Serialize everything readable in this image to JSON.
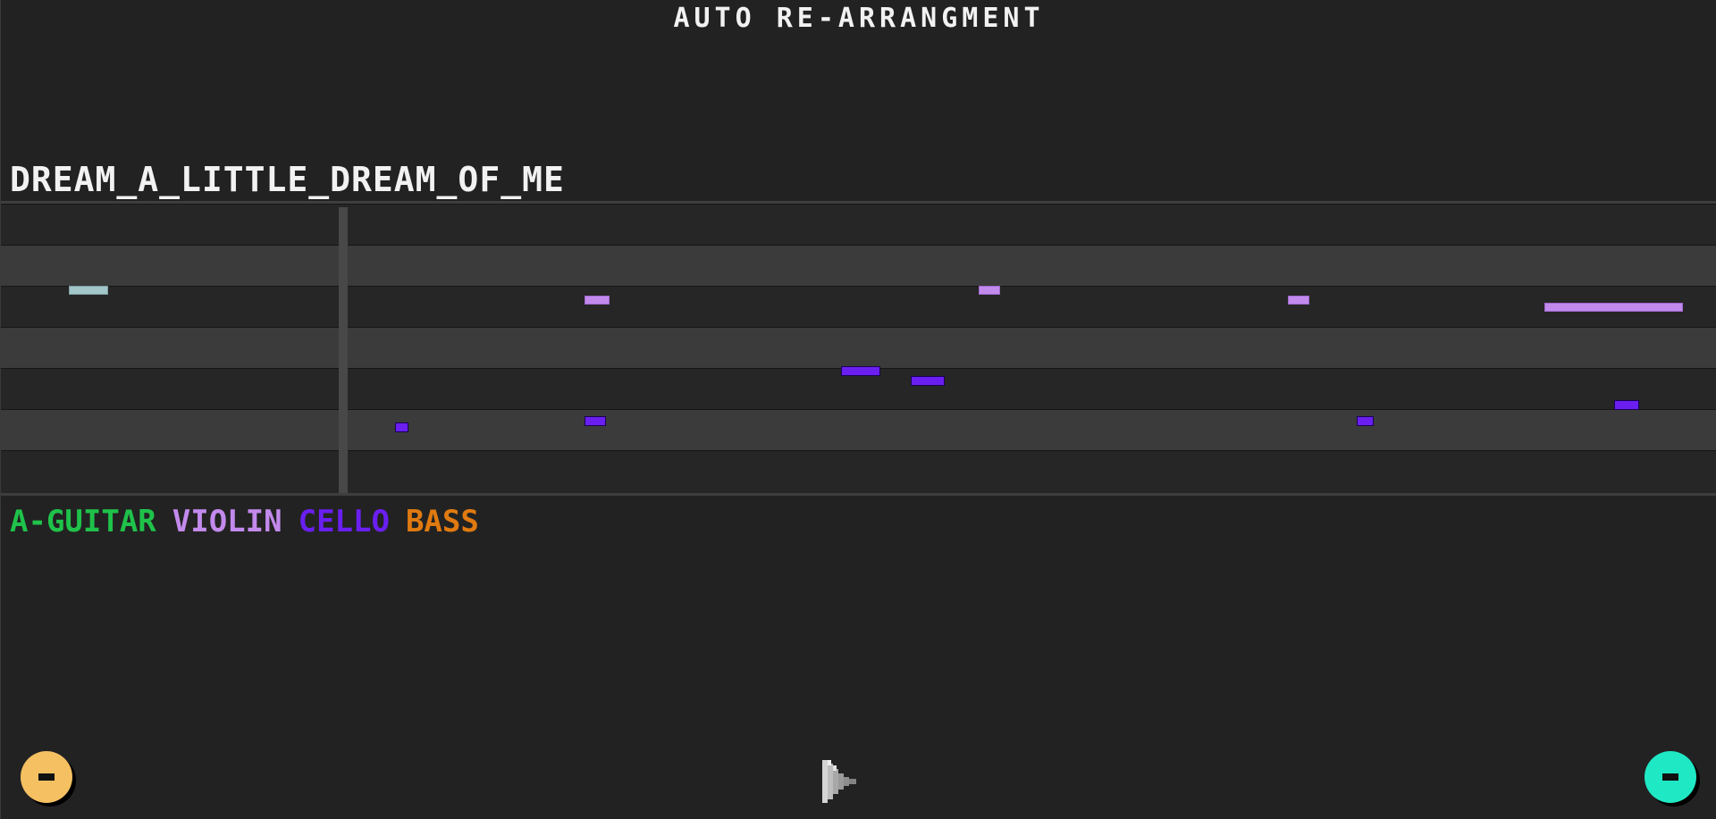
{
  "app": {
    "title": "AUTO RE-ARRANGMENT"
  },
  "song": {
    "title": "DREAM_A_LITTLE_DREAM_OF_ME"
  },
  "legend": [
    {
      "label": "A-GUITAR",
      "color": "#1fc24a"
    },
    {
      "label": "VIOLIN",
      "color": "#c38aed"
    },
    {
      "label": "CELLO",
      "color": "#6a1ff0"
    },
    {
      "label": "BASS",
      "color": "#e07a10"
    }
  ],
  "note_colors": {
    "guitar": "#a3c6c8",
    "violin": "#c38aed",
    "cello": "#6a1ff0"
  },
  "controls": {
    "left_button": {
      "icon": "minus-icon",
      "color": "#f4c062"
    },
    "play_button": {
      "icon": "play-icon",
      "color": "#c9c9c9"
    },
    "right_button": {
      "icon": "minus-icon",
      "color": "#1fe8c4"
    }
  }
}
